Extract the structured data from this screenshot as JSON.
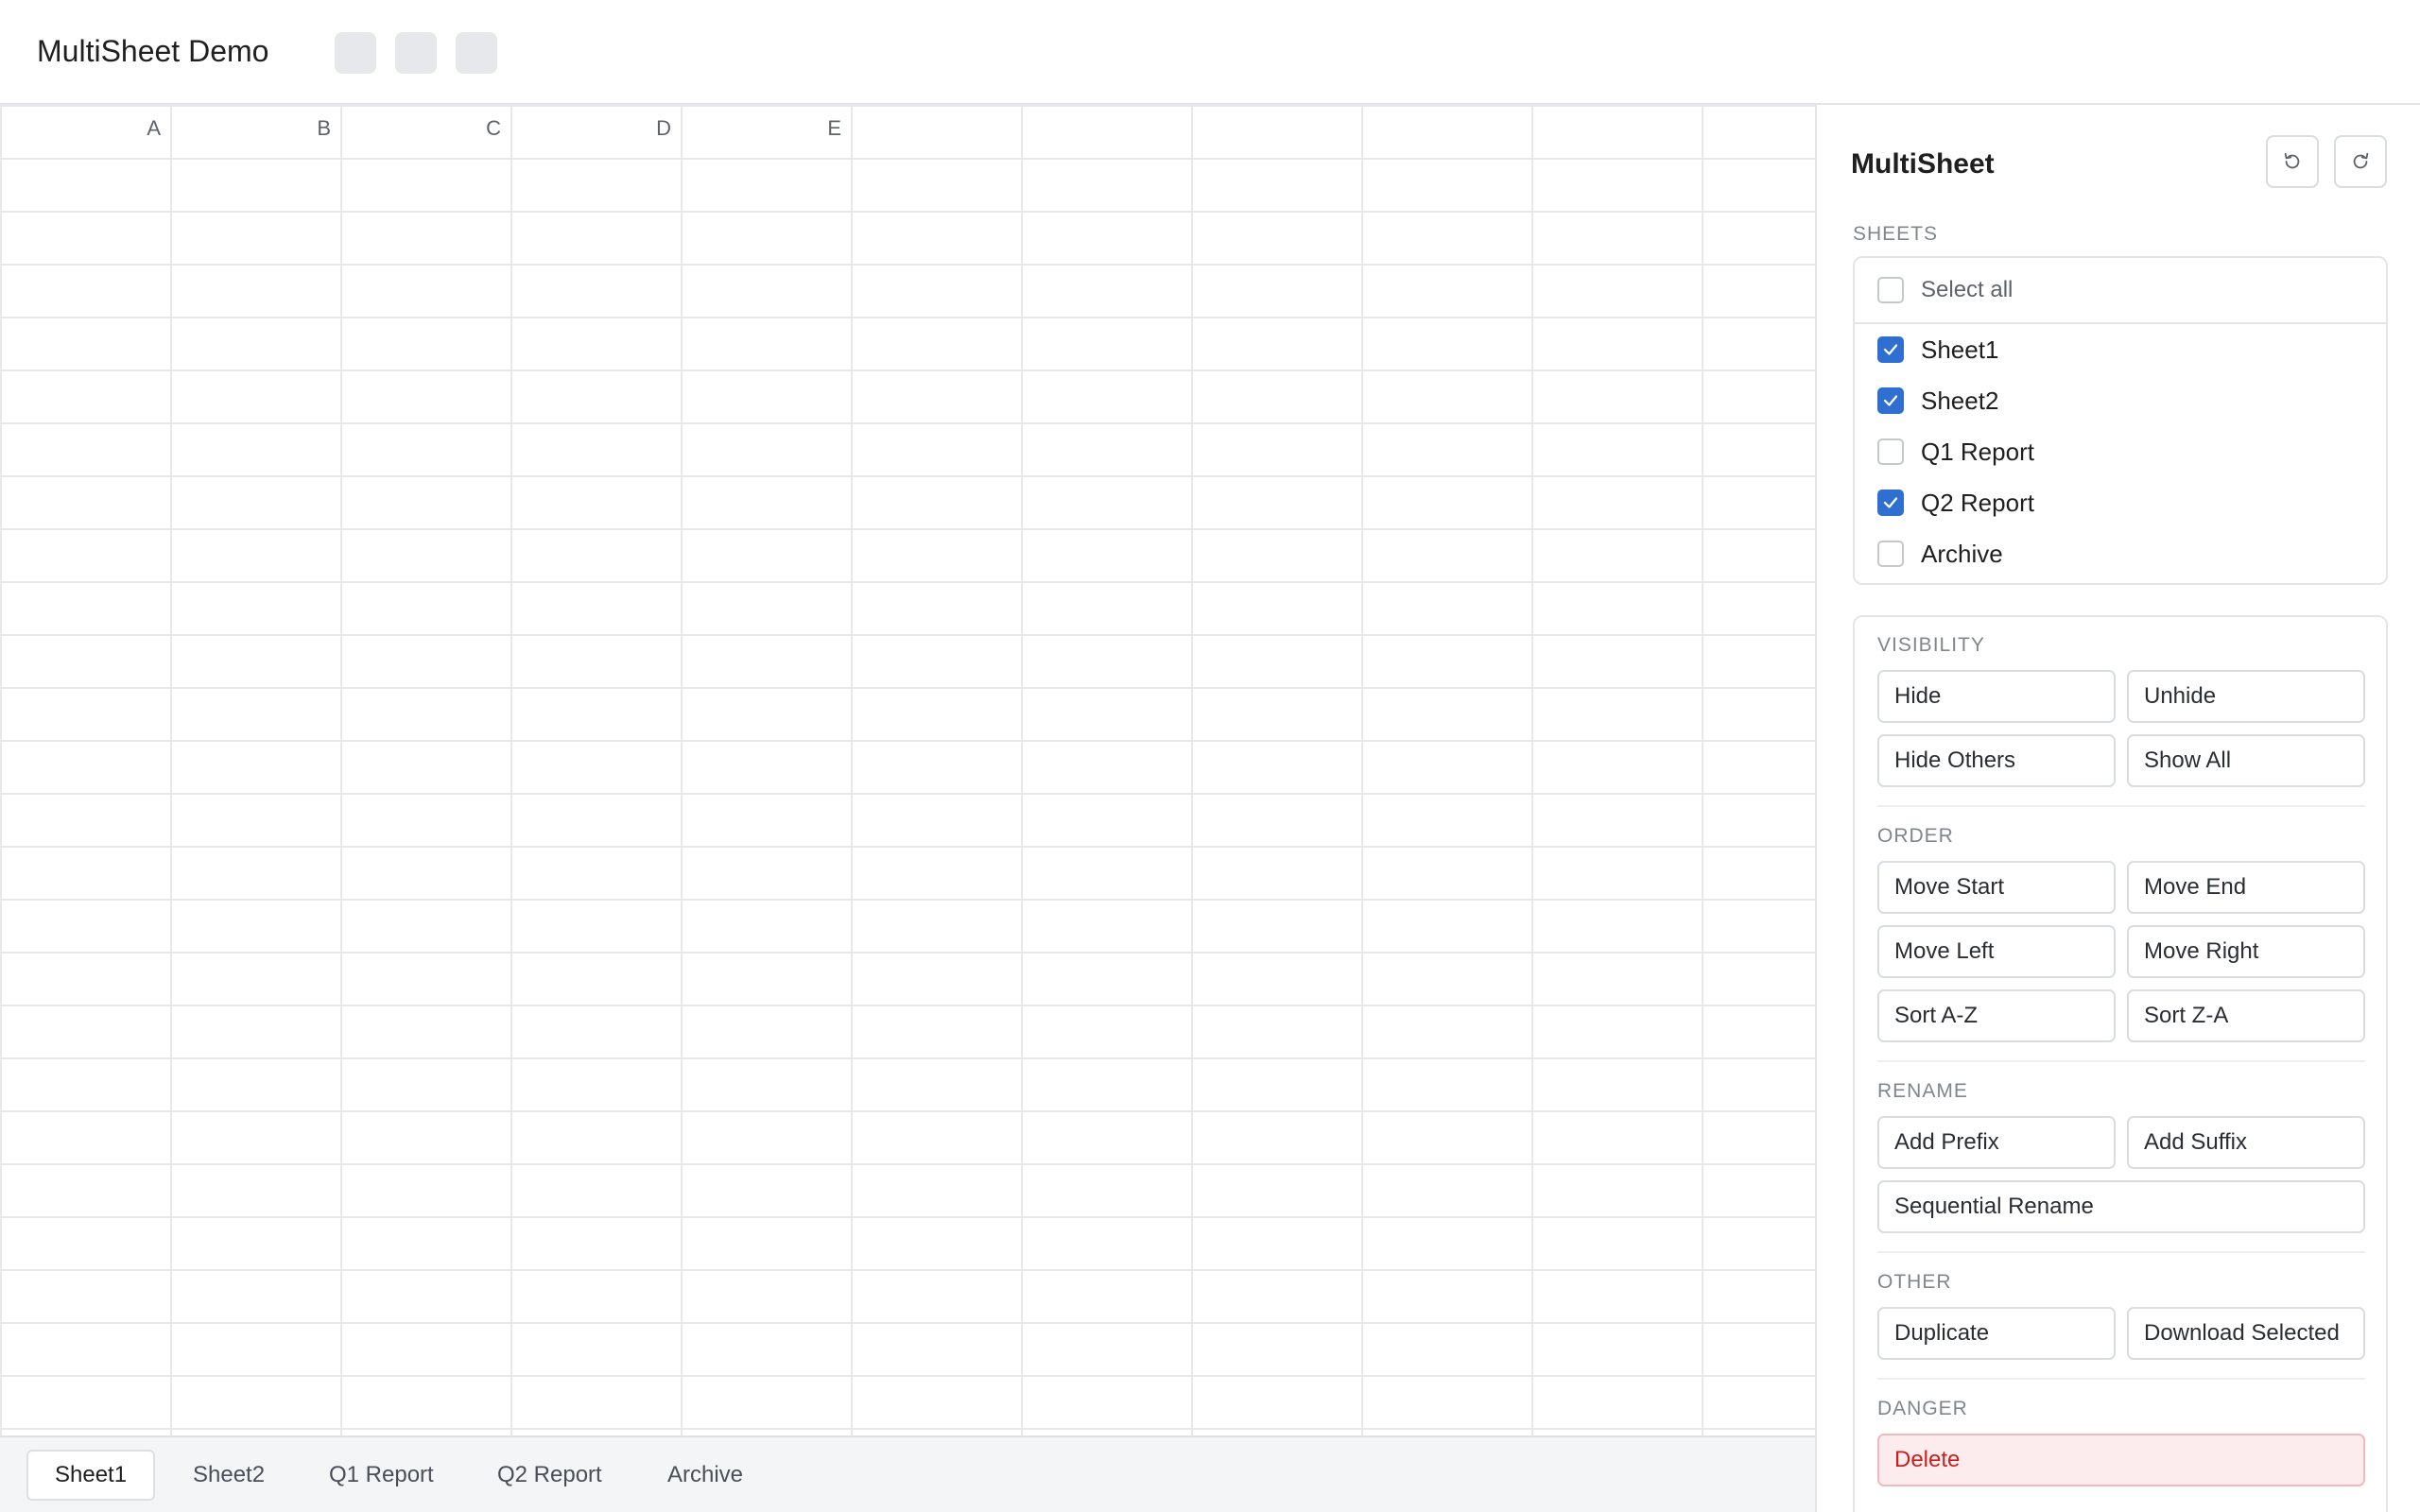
{
  "app": {
    "title": "MultiSheet Demo"
  },
  "grid": {
    "columns": [
      "A",
      "B",
      "C",
      "D",
      "E"
    ]
  },
  "tabs": [
    {
      "label": "Sheet1",
      "active": true
    },
    {
      "label": "Sheet2",
      "active": false
    },
    {
      "label": "Q1 Report",
      "active": false
    },
    {
      "label": "Q2 Report",
      "active": false
    },
    {
      "label": "Archive",
      "active": false
    }
  ],
  "panel": {
    "title": "MultiSheet",
    "icons": {
      "undo": "undo-icon",
      "redo": "redo-icon"
    },
    "sheets_label": "SHEETS",
    "select_all": {
      "label": "Select all",
      "checked": false
    },
    "sheets": [
      {
        "name": "Sheet1",
        "checked": true
      },
      {
        "name": "Sheet2",
        "checked": true
      },
      {
        "name": "Q1 Report",
        "checked": false
      },
      {
        "name": "Q2 Report",
        "checked": true
      },
      {
        "name": "Archive",
        "checked": false
      }
    ],
    "visibility": {
      "label": "VISIBILITY",
      "hide": "Hide",
      "unhide": "Unhide",
      "hide_others": "Hide Others",
      "show_all": "Show All"
    },
    "order": {
      "label": "ORDER",
      "move_start": "Move Start",
      "move_end": "Move End",
      "move_left": "Move Left",
      "move_right": "Move Right",
      "sort_az": "Sort A-Z",
      "sort_za": "Sort Z-A"
    },
    "rename": {
      "label": "RENAME",
      "add_prefix": "Add Prefix",
      "add_suffix": "Add Suffix",
      "sequential": "Sequential Rename"
    },
    "other": {
      "label": "OTHER",
      "duplicate": "Duplicate",
      "download_selected": "Download Selected"
    },
    "danger": {
      "label": "DANGER",
      "delete": "Delete"
    }
  },
  "colors": {
    "accent": "#2f6fd1",
    "danger_text": "#c5221f",
    "danger_bg": "#fdeced"
  }
}
